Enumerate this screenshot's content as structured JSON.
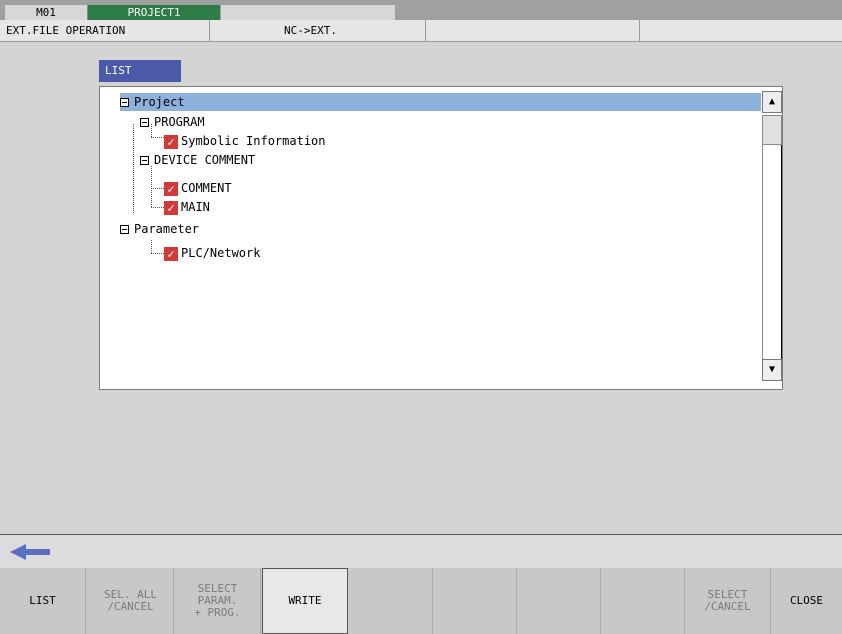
{
  "header": {
    "machine_tab": "M01",
    "project_tab": "PROJECT1"
  },
  "mode": {
    "operation": "EXT.FILE OPERATION",
    "direction": "NC->EXT."
  },
  "list_label": "LIST",
  "tree": {
    "items": [
      {
        "label": "Project"
      },
      {
        "label": "PROGRAM"
      },
      {
        "label": "Symbolic Information"
      },
      {
        "label": "DEVICE COMMENT"
      },
      {
        "label": "COMMENT"
      },
      {
        "label": "MAIN"
      },
      {
        "label": "Parameter"
      },
      {
        "label": "PLC/Network"
      }
    ]
  },
  "scrollbar": {
    "up_icon": "arrow-up-icon",
    "down_icon": "arrow-down-icon"
  },
  "softkeys": [
    {
      "label": "LIST"
    },
    {
      "label": "SEL. ALL\n/CANCEL"
    },
    {
      "label": "SELECT\nPARAM.\n+ PROG."
    },
    {
      "label": "WRITE"
    },
    {
      "label": ""
    },
    {
      "label": ""
    },
    {
      "label": ""
    },
    {
      "label": ""
    },
    {
      "label": "SELECT\n/CANCEL"
    },
    {
      "label": "CLOSE"
    }
  ],
  "colors": {
    "project_tab": "#2e7d47",
    "list_tab": "#4a5aa8",
    "selection": "#8eb0dd",
    "checkbox": "#d23a3a",
    "arrow": "#5a6fc0"
  }
}
